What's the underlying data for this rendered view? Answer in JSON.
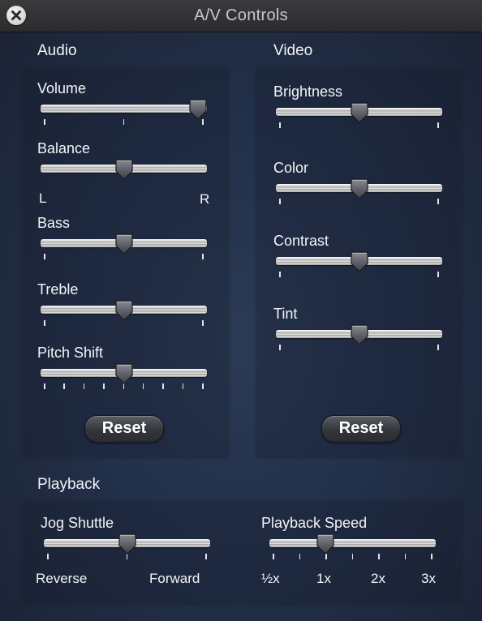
{
  "window": {
    "title": "A/V Controls"
  },
  "audio": {
    "section_label": "Audio",
    "volume": {
      "label": "Volume",
      "value": 0.97
    },
    "balance": {
      "label": "Balance",
      "value": 0.5,
      "left_label": "L",
      "right_label": "R"
    },
    "bass": {
      "label": "Bass",
      "value": 0.5
    },
    "treble": {
      "label": "Treble",
      "value": 0.5
    },
    "pitch_shift": {
      "label": "Pitch Shift",
      "value": 0.5
    },
    "reset_label": "Reset"
  },
  "video": {
    "section_label": "Video",
    "brightness": {
      "label": "Brightness",
      "value": 0.5
    },
    "color": {
      "label": "Color",
      "value": 0.5
    },
    "contrast": {
      "label": "Contrast",
      "value": 0.5
    },
    "tint": {
      "label": "Tint",
      "value": 0.5
    },
    "reset_label": "Reset"
  },
  "playback": {
    "section_label": "Playback",
    "jog_shuttle": {
      "label": "Jog Shuttle",
      "value": 0.5,
      "left_label": "Reverse",
      "right_label": "Forward"
    },
    "playback_speed": {
      "label": "Playback Speed",
      "value": 0.33,
      "tick_labels": [
        "½x",
        "1x",
        "2x",
        "3x"
      ]
    }
  },
  "colors": {
    "background": "#22304a",
    "titlebar": "#2c2c2e",
    "text": "#eef0f4"
  }
}
